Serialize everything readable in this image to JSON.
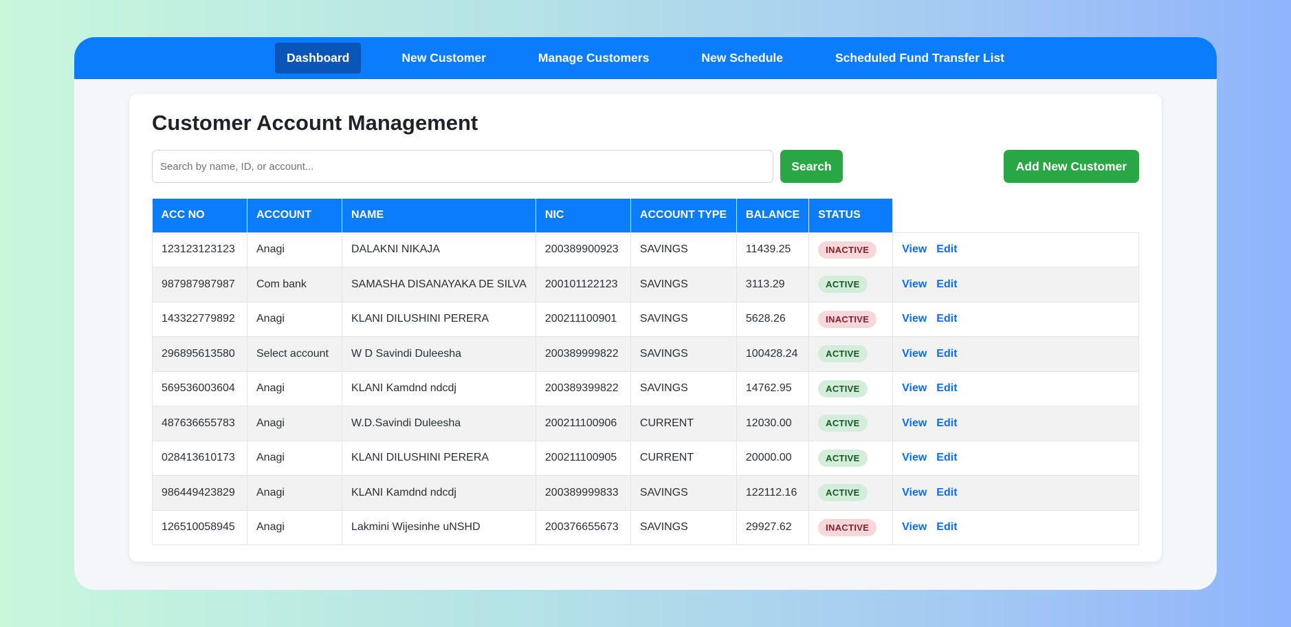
{
  "nav": {
    "items": [
      {
        "label": "Dashboard",
        "active": true
      },
      {
        "label": "New Customer",
        "active": false
      },
      {
        "label": "Manage Customers",
        "active": false
      },
      {
        "label": "New Schedule",
        "active": false
      },
      {
        "label": "Scheduled Fund Transfer List",
        "active": false
      }
    ]
  },
  "page": {
    "title": "Customer Account Management"
  },
  "search": {
    "placeholder": "Search by name, ID, or account...",
    "value": "",
    "button_label": "Search"
  },
  "add_button_label": "Add New Customer",
  "table": {
    "headers": [
      "ACC NO",
      "ACCOUNT",
      "NAME",
      "NIC",
      "ACCOUNT TYPE",
      "BALANCE",
      "STATUS"
    ],
    "action_labels": {
      "view": "View",
      "edit": "Edit"
    },
    "rows": [
      {
        "acc_no": "123123123123",
        "account": "Anagi",
        "name": "DALAKNI NIKAJA",
        "nic": "200389900923",
        "type": "SAVINGS",
        "balance": "11439.25",
        "status": "INACTIVE"
      },
      {
        "acc_no": "987987987987",
        "account": "Com bank",
        "name": "SAMASHA DISANAYAKA DE SILVA",
        "nic": "200101122123",
        "type": "SAVINGS",
        "balance": "3113.29",
        "status": "ACTIVE"
      },
      {
        "acc_no": "143322779892",
        "account": "Anagi",
        "name": "KLANI DILUSHINI PERERA",
        "nic": "200211100901",
        "type": "SAVINGS",
        "balance": "5628.26",
        "status": "INACTIVE"
      },
      {
        "acc_no": "296895613580",
        "account": "Select account",
        "name": "W D Savindi Duleesha",
        "nic": "200389999822",
        "type": "SAVINGS",
        "balance": "100428.24",
        "status": "ACTIVE"
      },
      {
        "acc_no": "569536003604",
        "account": "Anagi",
        "name": "KLANI Kamdnd ndcdj",
        "nic": "200389399822",
        "type": "SAVINGS",
        "balance": "14762.95",
        "status": "ACTIVE"
      },
      {
        "acc_no": "487636655783",
        "account": "Anagi",
        "name": "W.D.Savindi Duleesha",
        "nic": "200211100906",
        "type": "CURRENT",
        "balance": "12030.00",
        "status": "ACTIVE"
      },
      {
        "acc_no": "028413610173",
        "account": "Anagi",
        "name": "KLANI DILUSHINI PERERA",
        "nic": "200211100905",
        "type": "CURRENT",
        "balance": "20000.00",
        "status": "ACTIVE"
      },
      {
        "acc_no": "986449423829",
        "account": "Anagi",
        "name": "KLANI Kamdnd ndcdj",
        "nic": "200389999833",
        "type": "SAVINGS",
        "balance": "122112.16",
        "status": "ACTIVE"
      },
      {
        "acc_no": "126510058945",
        "account": "Anagi",
        "name": "Lakmini Wijesinhe uNSHD",
        "nic": "200376655673",
        "type": "SAVINGS",
        "balance": "29927.62",
        "status": "INACTIVE"
      }
    ]
  },
  "colors": {
    "primary": "#0a7cfc",
    "nav_active": "#0a56b8",
    "success": "#28a744",
    "inactive_badge_bg": "#f8d7da",
    "active_badge_bg": "#d4edda",
    "link": "#0a6ef0"
  }
}
